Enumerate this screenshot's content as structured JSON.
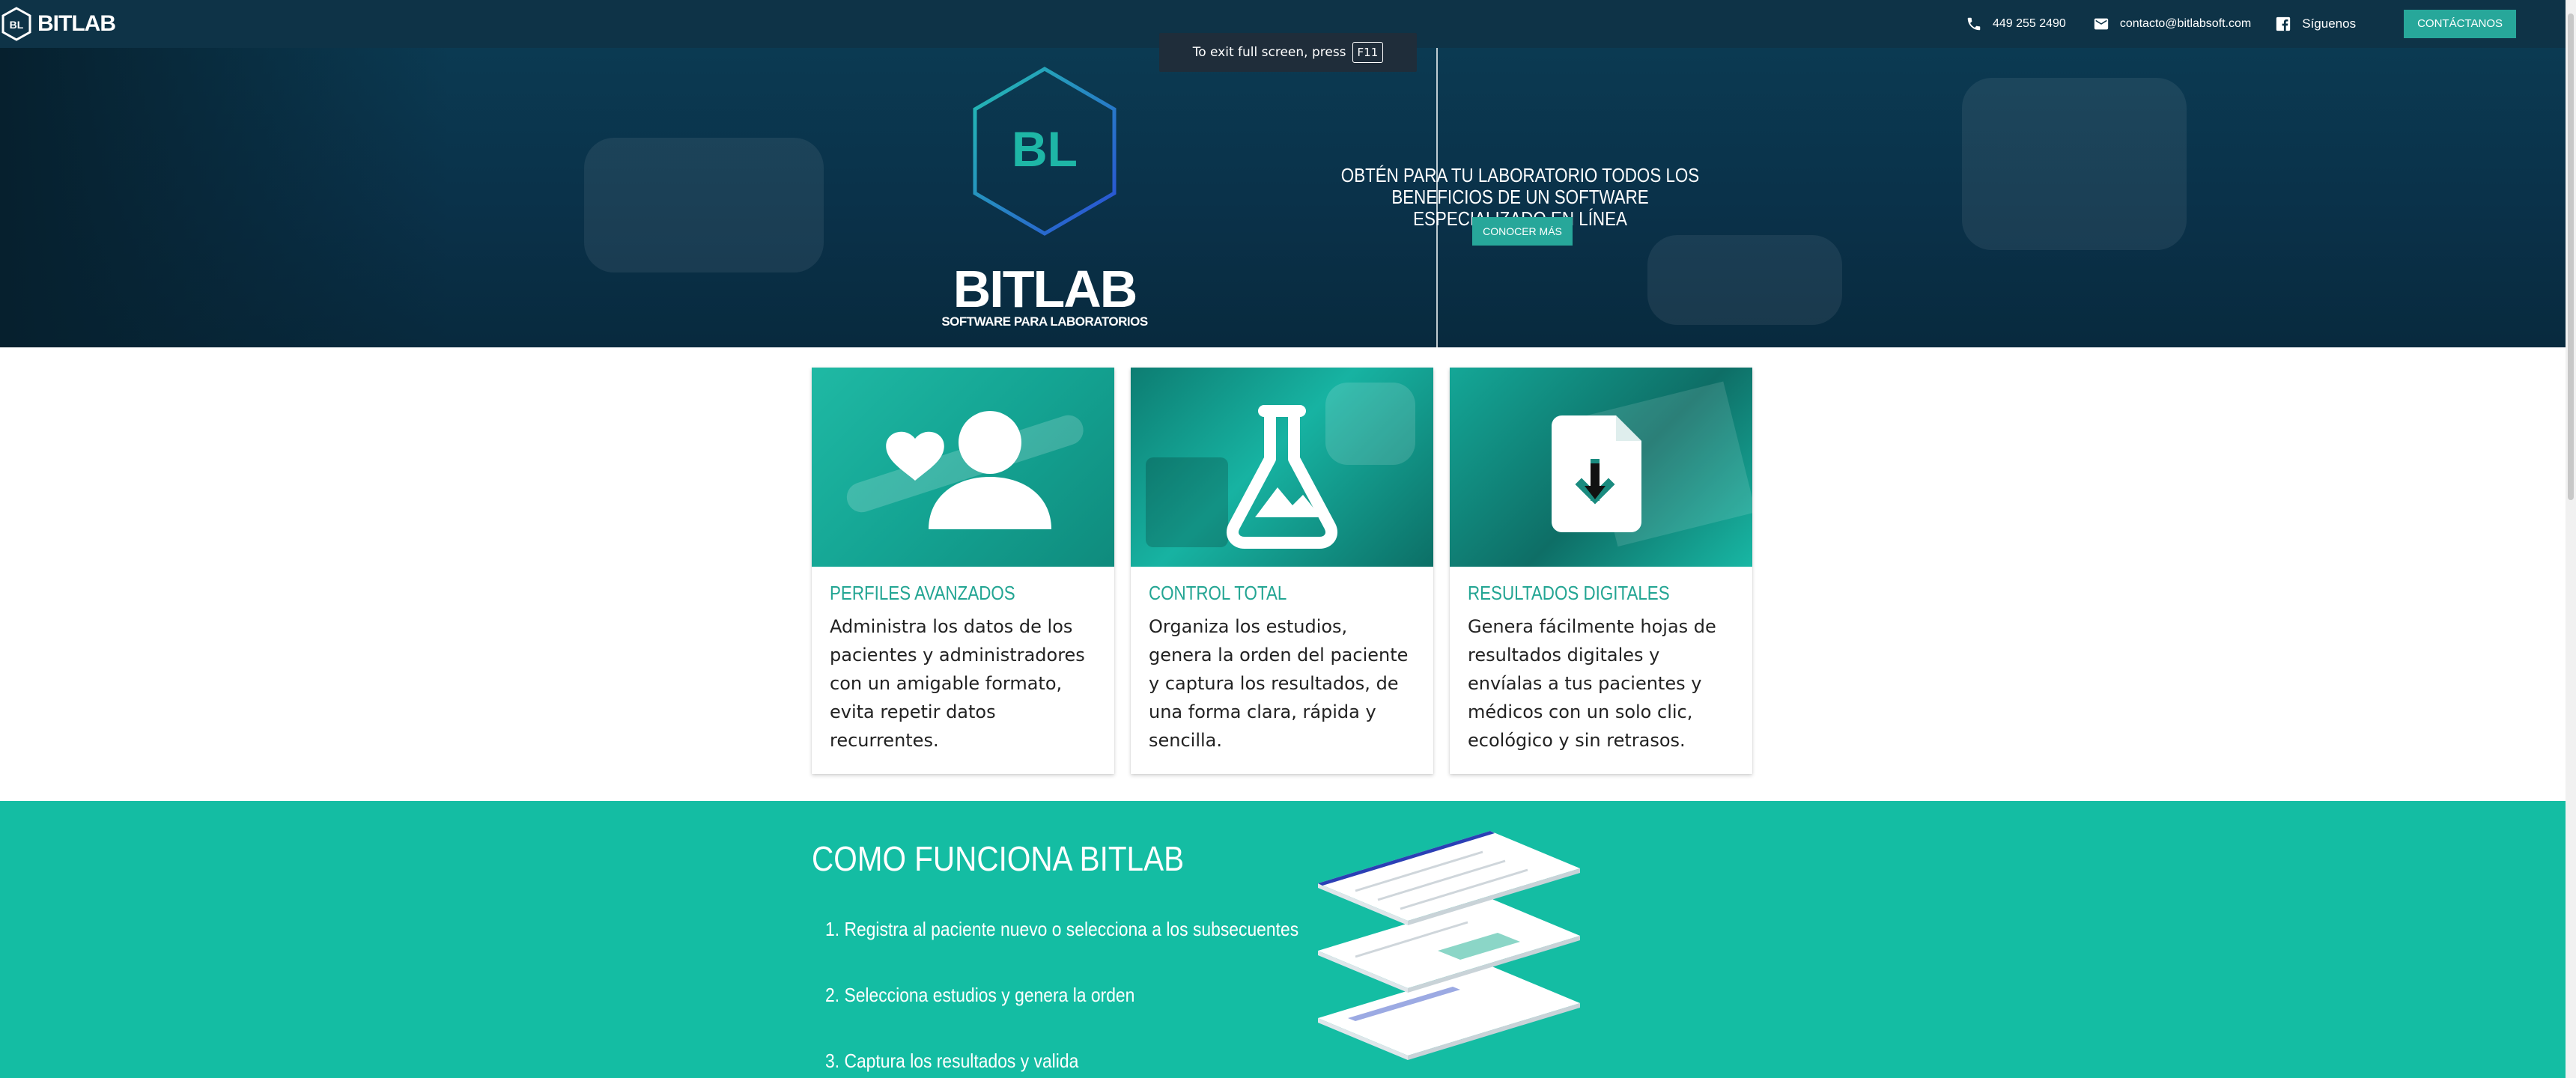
{
  "nav": {
    "brand": "BITLAB",
    "phone": "449 255 2490",
    "email": "contacto@bitlabsoft.com",
    "social_label": "Síguenos",
    "contact_button": "CONTÁCTANOS",
    "icons": {
      "phone": "phone-icon",
      "email": "mail-icon",
      "social": "facebook-icon"
    }
  },
  "fullscreen_notice": {
    "text": "To exit full screen, press",
    "key": "F11"
  },
  "hero": {
    "logo_initials": "BL",
    "logo_title": "BITLAB",
    "logo_subtitle": "SOFTWARE PARA LABORATORIOS",
    "headline": "OBTÉN PARA TU LABORATORIO TODOS LOS BENEFICIOS DE UN SOFTWARE ESPECIALIZADO EN LÍNEA",
    "cta": "CONOCER MÁS"
  },
  "features": [
    {
      "icon": "user-heart-icon",
      "title": "PERFILES AVANZADOS",
      "description": "Administra los datos de los pacientes y administradores con un amigable formato, evita repetir datos recurrentes."
    },
    {
      "icon": "flask-icon",
      "title": "CONTROL TOTAL",
      "description": "Organiza los estudios, genera la orden del paciente y captura los resultados, de una forma clara, rápida y sencilla."
    },
    {
      "icon": "document-download-icon",
      "title": "RESULTADOS DIGITALES",
      "description": "Genera fácilmente hojas de resultados digitales y envíalas a tus pacientes y médicos con un solo clic, ecológico y sin retrasos."
    }
  ],
  "how_it_works": {
    "title": "COMO FUNCIONA BITLAB",
    "steps": [
      "1. Registra al paciente nuevo o selecciona a los subsecuentes",
      "2. Selecciona estudios y genera la orden",
      "3. Captura los resultados y valida"
    ]
  },
  "colors": {
    "navbar": "#0e3347",
    "accent": "#27a79a",
    "teal_section": "#14bda3",
    "card_title": "#23a593"
  }
}
